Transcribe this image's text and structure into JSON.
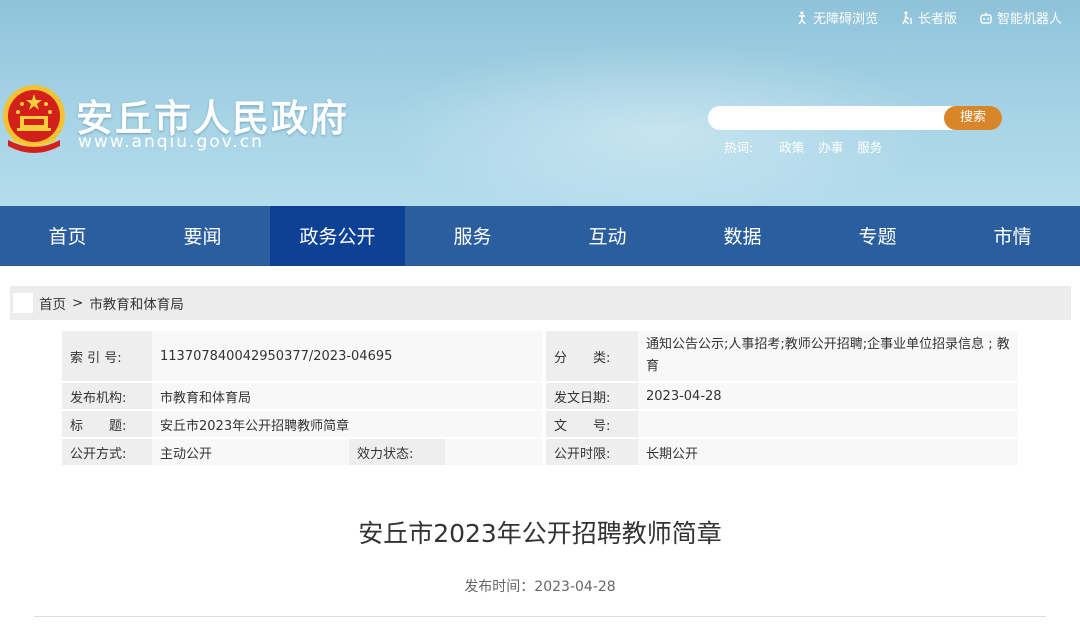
{
  "top_links": [
    {
      "label": "无障碍浏览",
      "icon": "accessibility-icon"
    },
    {
      "label": "长者版",
      "icon": "elder-icon"
    },
    {
      "label": "智能机器人",
      "icon": "robot-icon"
    }
  ],
  "site": {
    "title": "安丘市人民政府",
    "url": "www.anqiu.gov.cn"
  },
  "search": {
    "placeholder": "",
    "button_label": "搜索",
    "hot_label": "热词:",
    "hot_words": [
      "政策",
      "办事",
      "服务"
    ]
  },
  "nav": {
    "items": [
      "首页",
      "要闻",
      "政务公开",
      "服务",
      "互动",
      "数据",
      "专题",
      "市情"
    ],
    "active_index": 2
  },
  "breadcrumb": {
    "home": "首页",
    "separator": ">",
    "current": "市教育和体育局"
  },
  "info": {
    "index_label": "索 引 号:",
    "index_value": "113707840042950377/2023-04695",
    "category_label": "分　　类:",
    "category_value": "通知公告公示;人事招考;教师公开招聘;企事业单位招录信息 ; 教育",
    "publisher_label": "发布机构:",
    "publisher_value": "市教育和体育局",
    "date_label": "发文日期:",
    "date_value": "2023-04-28",
    "title_label": "标　　题:",
    "title_value": "安丘市2023年公开招聘教师简章",
    "doc_no_label": "文　　号:",
    "doc_no_value": "",
    "method_label": "公开方式:",
    "method_value": "主动公开",
    "status_label": "效力状态:",
    "status_value": "",
    "period_label": "公开时限:",
    "period_value": "长期公开"
  },
  "article": {
    "title": "安丘市2023年公开招聘教师简章",
    "pub_time": "发布时间：2023-04-28"
  },
  "colors": {
    "nav_bg": "#2b5e9e",
    "nav_active": "#0d4196",
    "search_button": "#d9862b",
    "header_sky": "#a6d3e6"
  }
}
